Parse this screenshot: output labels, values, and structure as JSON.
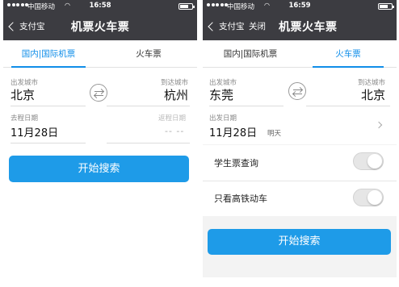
{
  "left": {
    "status": {
      "carrier": "中国移动",
      "time": "16:58"
    },
    "nav": {
      "back": "支付宝",
      "title": "机票火车票"
    },
    "tabs": [
      "国内|国际机票",
      "火车票"
    ],
    "from_label": "出发城市",
    "from_city": "北京",
    "to_label": "到达城市",
    "to_city": "杭州",
    "depart_label": "去程日期",
    "depart_date": "11月28日",
    "return_label": "返程日期",
    "return_value": "-- --",
    "search_button": "开始搜索"
  },
  "right": {
    "status": {
      "carrier": "中国移动",
      "time": "16:59"
    },
    "nav": {
      "back": "支付宝",
      "close": "关闭",
      "title": "机票火车票"
    },
    "tabs": [
      "国内|国际机票",
      "火车票"
    ],
    "from_label": "出发城市",
    "from_city": "东莞",
    "to_label": "到达城市",
    "to_city": "北京",
    "depart_label": "出发日期",
    "depart_date": "11月28日",
    "depart_day": "明天",
    "student_label": "学生票查询",
    "highspeed_label": "只看高铁动车",
    "search_button": "开始搜索"
  },
  "colors": {
    "accent": "#108ee9",
    "button": "#1e9be8",
    "navbar": "#3c3c41",
    "highlight": "#ee6aa0"
  }
}
